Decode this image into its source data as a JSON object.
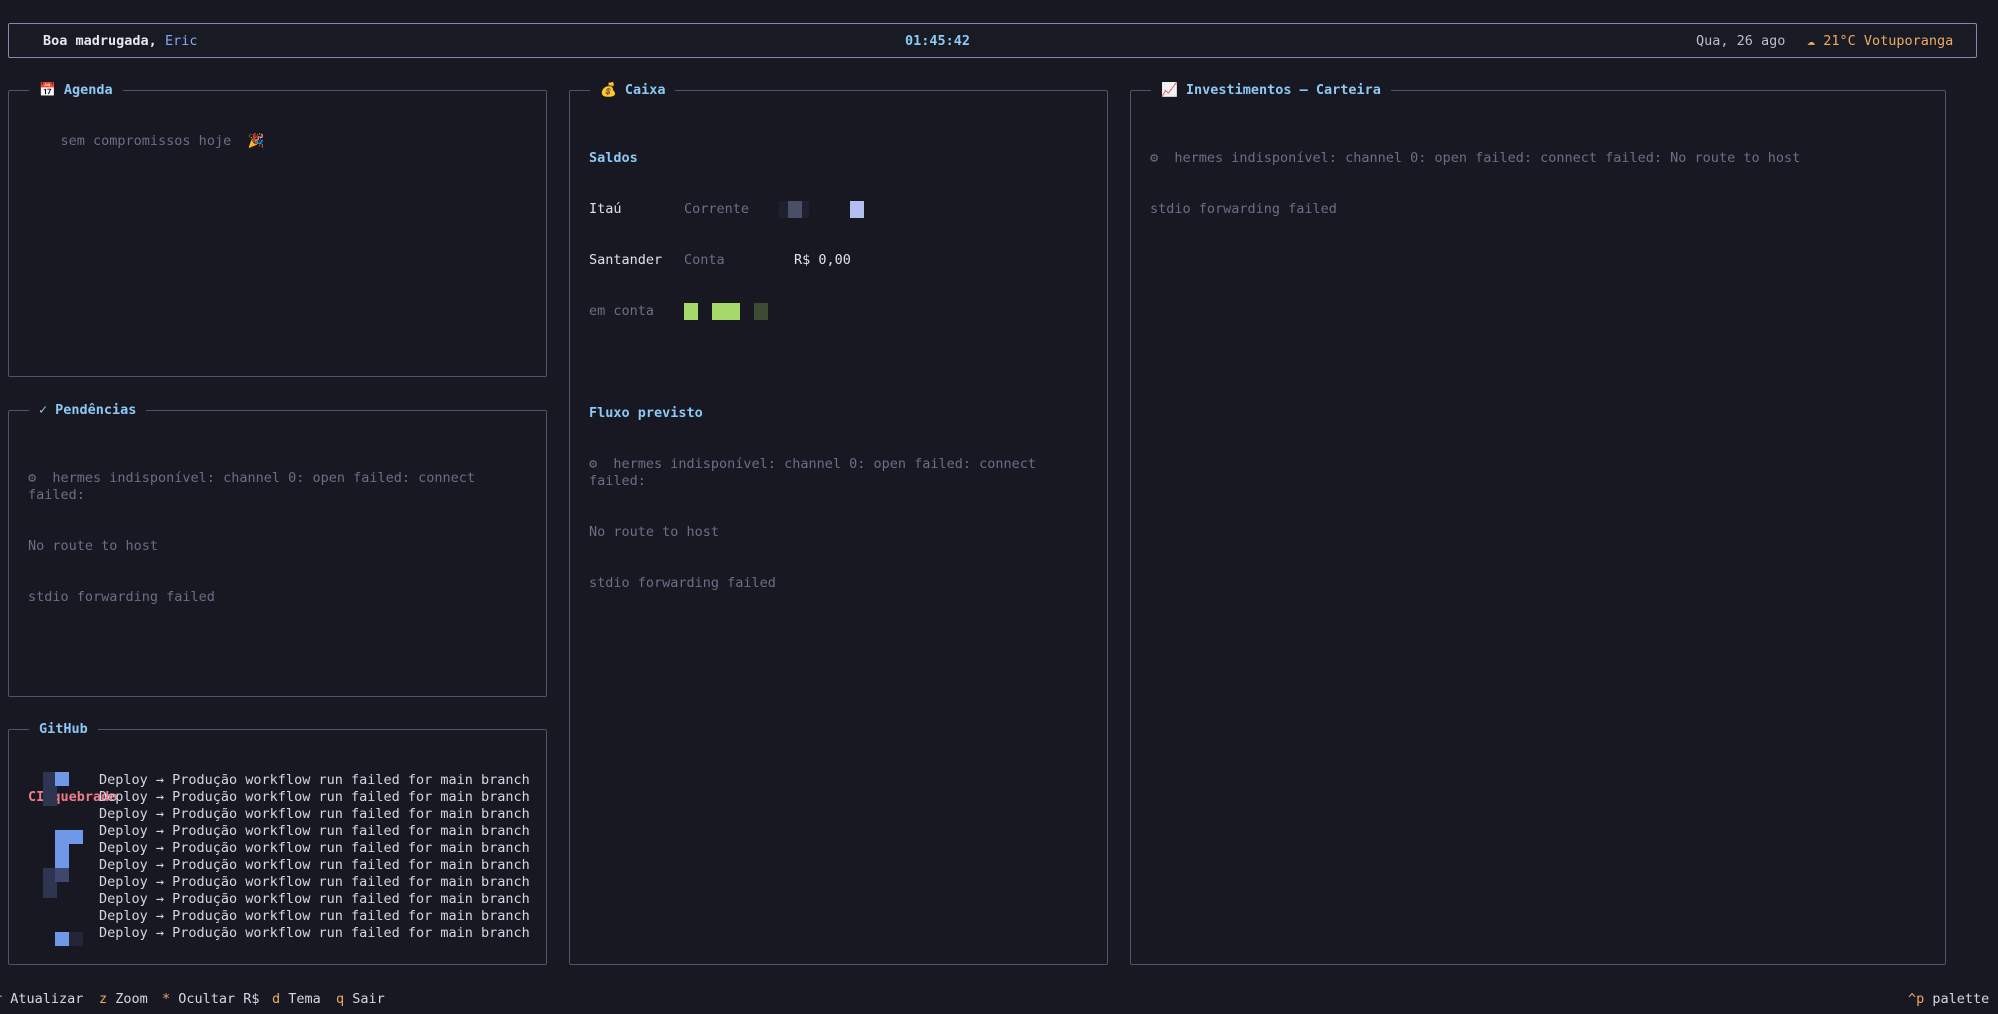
{
  "header": {
    "greeting": "Boa madrugada,",
    "user": "Eric",
    "clock": "01:45:42",
    "date": "Qua, 26 ago",
    "weather": "☁ 21°C Votuporanga"
  },
  "agenda": {
    "title": "Agenda",
    "icon": "calendar-icon",
    "empty_text": "sem compromissos hoje  🎉"
  },
  "pendencias": {
    "title": "Pendências",
    "icon": "check-icon",
    "error_line1": "⚙  hermes indisponível: channel 0: open failed: connect failed:",
    "error_line2": "No route to host",
    "error_line3": "stdio forwarding failed"
  },
  "github": {
    "title": "GitHub",
    "ci_title": "CI quebrado",
    "runs": [
      "Deploy → Produção workflow run failed for main branch",
      "Deploy → Produção workflow run failed for main branch",
      "Deploy → Produção workflow run failed for main branch",
      "Deploy → Produção workflow run failed for main branch",
      "Deploy → Produção workflow run failed for main branch",
      "Deploy → Produção workflow run failed for main branch",
      "Deploy → Produção workflow run failed for main branch",
      "Deploy → Produção workflow run failed for main branch",
      "Deploy → Produção workflow run failed for main branch",
      "Deploy → Produção workflow run failed for main branch"
    ]
  },
  "caixa": {
    "title": "Caixa",
    "icon": "money-bag-icon",
    "saldos_label": "Saldos",
    "accounts": [
      {
        "bank": "Itaú",
        "type": "Corrente",
        "amount": ""
      },
      {
        "bank": "Santander",
        "type": "Conta",
        "amount": "R$ 0,00"
      },
      {
        "bank": "em conta",
        "type": "",
        "amount": ""
      }
    ],
    "fluxo_label": "Fluxo previsto",
    "error_line1": "⚙  hermes indisponível: channel 0: open failed: connect failed:",
    "error_line2": "No route to host",
    "error_line3": "stdio forwarding failed",
    "colors": {
      "accent": "#8ec8f5",
      "green": "#a6d96a",
      "lavender": "#b4bef0"
    }
  },
  "investimentos": {
    "title": "Investimentos — Carteira",
    "icon": "chart-up-icon",
    "error_line1": "⚙  hermes indisponível: channel 0: open failed: connect failed: No route to host",
    "error_line2": "stdio forwarding failed"
  },
  "footer": {
    "refresh_key": "r",
    "refresh_label": "Atualizar",
    "zoom_key": "z",
    "zoom_label": "Zoom",
    "hide_key": "*",
    "hide_label": "Ocultar R$",
    "theme_key": "d",
    "theme_label": "Tema",
    "quit_key": "q",
    "quit_label": "Sair",
    "palette_key": "^p",
    "palette_label": "palette"
  }
}
